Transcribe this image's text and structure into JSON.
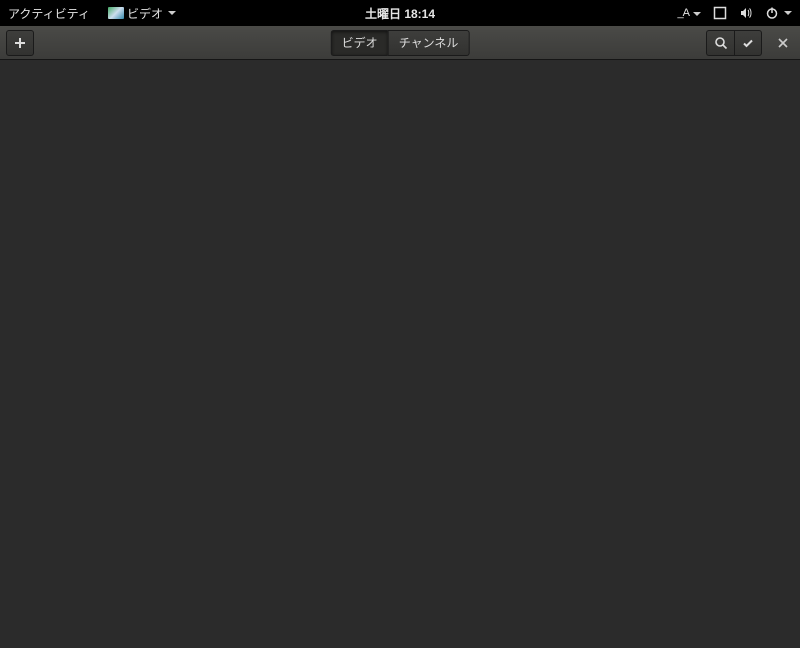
{
  "topbar": {
    "activities": "アクティビティ",
    "app_name": "ビデオ",
    "clock": "土曜日 18:14",
    "ime": "_A"
  },
  "header": {
    "tabs": {
      "video": "ビデオ",
      "channel": "チャンネル"
    }
  }
}
